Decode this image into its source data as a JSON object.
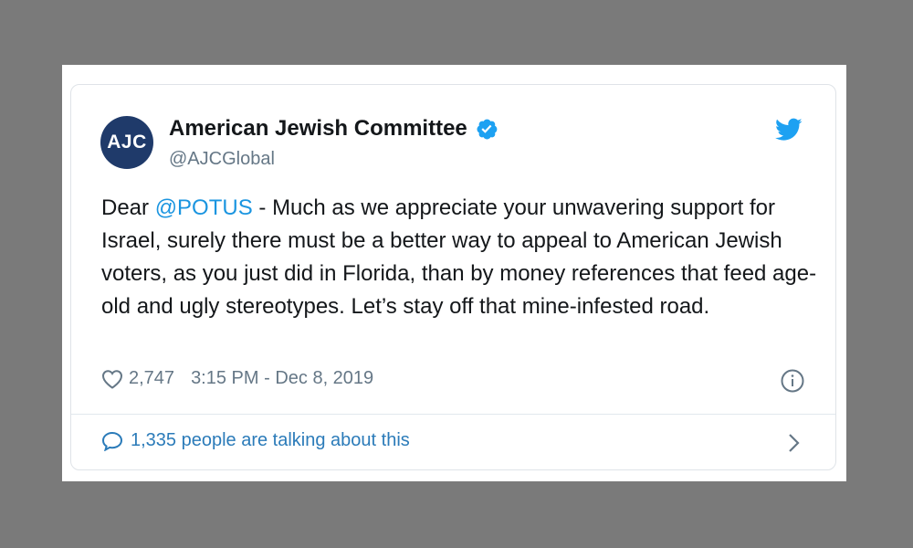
{
  "tweet": {
    "avatar_text": "AJC",
    "display_name": "American Jewish Committee",
    "handle": "@AJCGlobal",
    "verified": true,
    "text_before_mention": "Dear ",
    "mention": "@POTUS",
    "text_after_mention": " - Much as we appreciate your unwavering support for Israel, surely there must be a better way to appeal to American Jewish voters, as you just did in Florida, than by money references that feed age-old and ugly stereotypes. Let’s stay off that mine-infested road.",
    "likes": "2,747",
    "timestamp": "3:15 PM - Dec 8, 2019",
    "talking": "1,335 people are talking about this"
  },
  "icons": {
    "verified": "verified-badge-icon",
    "brand": "twitter-bird-icon",
    "like": "heart-icon",
    "info": "info-icon",
    "reply": "speech-bubble-icon",
    "more": "chevron-right-icon"
  },
  "colors": {
    "background": "#7a7a7a",
    "avatar": "#1f3a6a",
    "link": "#1b95e0",
    "talking_link": "#2b7bb9",
    "muted": "#657786",
    "text": "#14171a"
  }
}
